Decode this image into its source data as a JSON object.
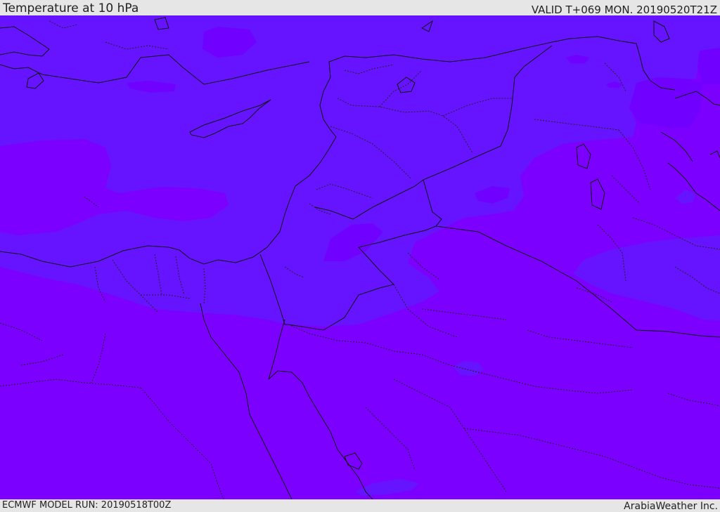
{
  "header": {
    "title": "Temperature at 10 hPa",
    "valid_time": "VALID T+069 MON. 20190520T21Z"
  },
  "footer": {
    "model_run": "ECMWF MODEL RUN: 20190518T00Z",
    "provider": "ArabiaWeather Inc."
  },
  "map": {
    "field": "Temperature",
    "level": "10 hPa",
    "colors": {
      "warm_band": "#7c00ff",
      "cool_band": "#6614ff",
      "coastline": "#111111",
      "borders": "#111111"
    }
  }
}
